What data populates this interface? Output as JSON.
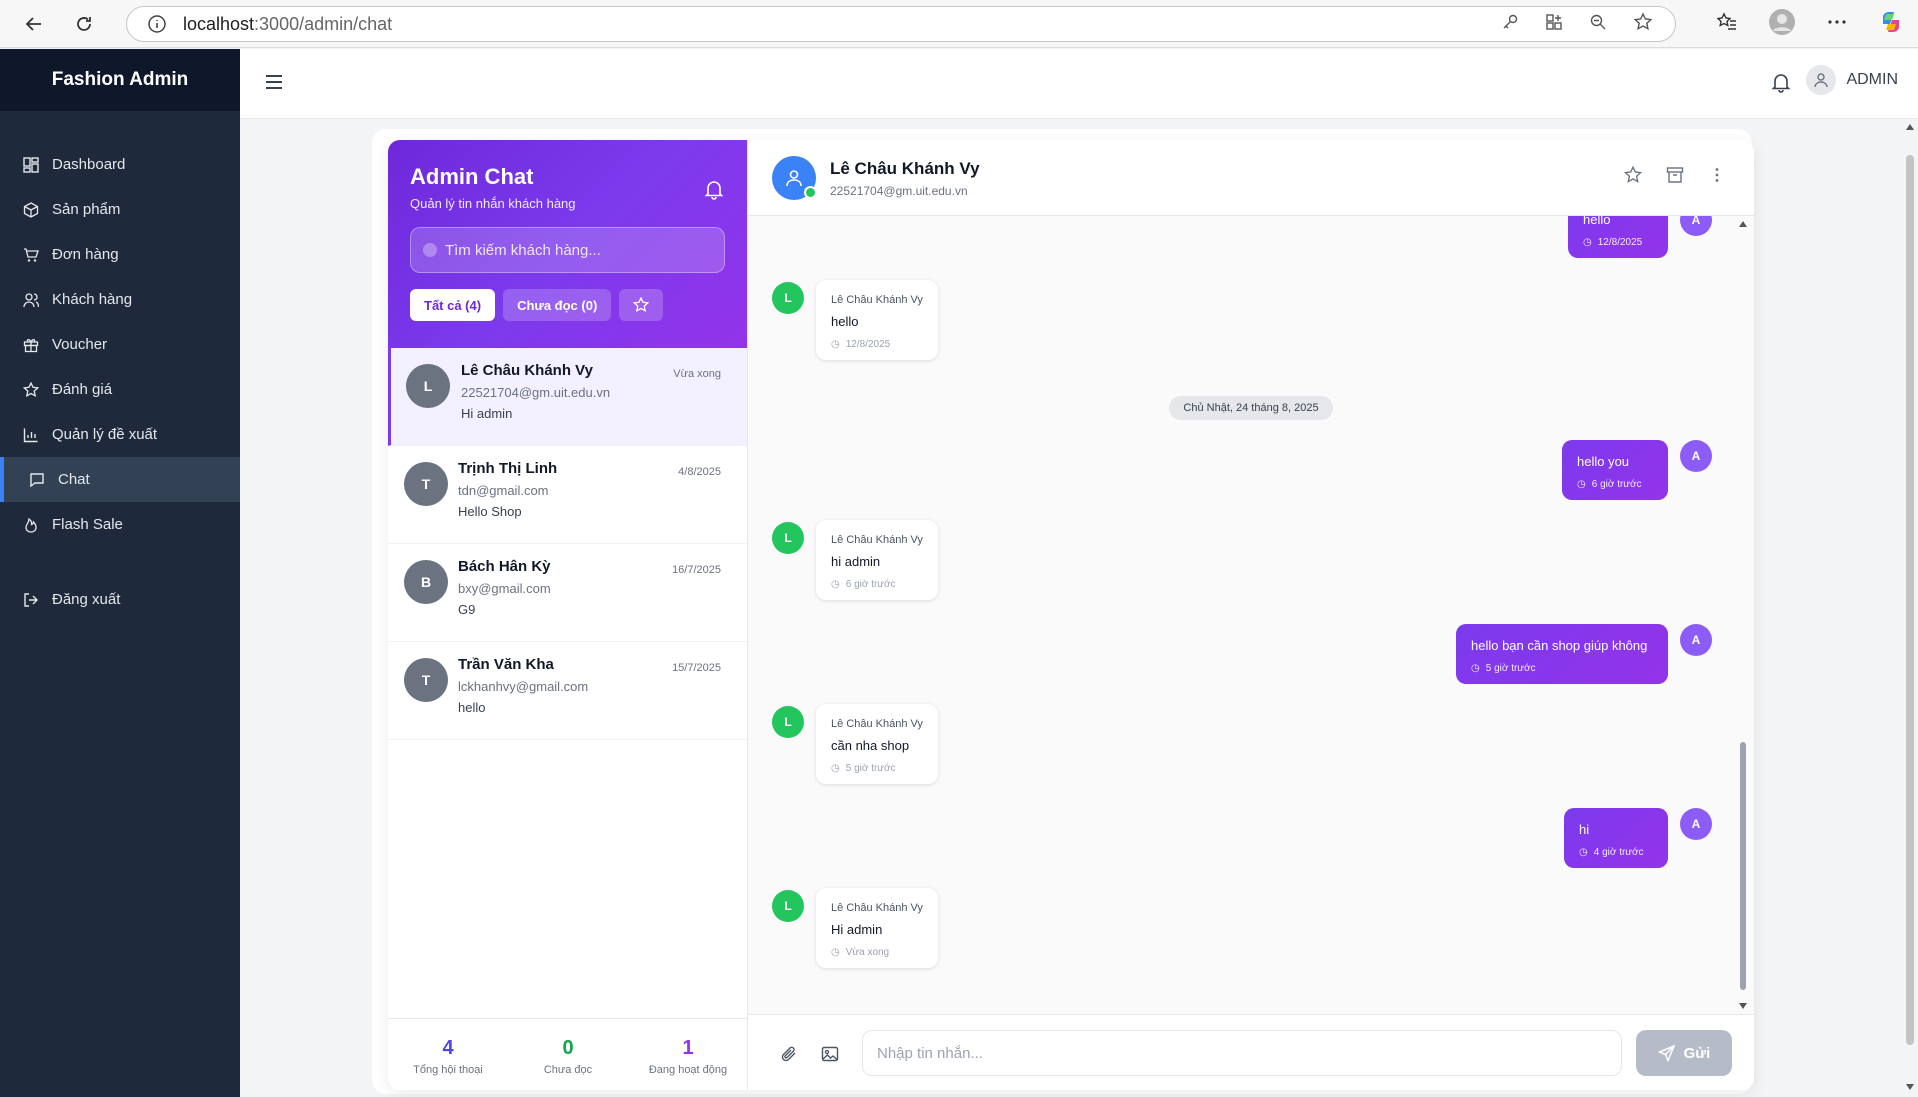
{
  "browser": {
    "url_host": "localhost",
    "url_path": ":3000/admin/chat"
  },
  "sidebar": {
    "brand": "Fashion Admin",
    "items": [
      {
        "label": "Dashboard",
        "icon": "dashboard-icon"
      },
      {
        "label": "Sản phẩm",
        "icon": "box-icon"
      },
      {
        "label": "Đơn hàng",
        "icon": "cart-icon"
      },
      {
        "label": "Khách hàng",
        "icon": "users-icon"
      },
      {
        "label": "Voucher",
        "icon": "gift-icon"
      },
      {
        "label": "Đánh giá",
        "icon": "star-icon"
      },
      {
        "label": "Quản lý đề xuất",
        "icon": "chart-icon"
      },
      {
        "label": "Chat",
        "icon": "chat-icon",
        "active": true
      },
      {
        "label": "Flash Sale",
        "icon": "flame-icon"
      }
    ],
    "logout": "Đăng xuất"
  },
  "topbar": {
    "user_label": "ADMIN"
  },
  "chat_list": {
    "title": "Admin Chat",
    "subtitle": "Quản lý tin nhắn khách hàng",
    "search_placeholder": "Tìm kiếm khách hàng...",
    "filters": {
      "all": "Tất cả (4)",
      "unread": "Chưa đọc (0)"
    },
    "conversations": [
      {
        "initial": "L",
        "name": "Lê Châu Khánh Vy",
        "email": "22521704@gm.uit.edu.vn",
        "last": "Hi admin",
        "time": "Vừa xong"
      },
      {
        "initial": "T",
        "name": "Trịnh Thị Linh",
        "email": "tdn@gmail.com",
        "last": "Hello Shop",
        "time": "4/8/2025"
      },
      {
        "initial": "B",
        "name": "Bách Hân Kỳ",
        "email": "bxy@gmail.com",
        "last": "G9",
        "time": "16/7/2025"
      },
      {
        "initial": "T",
        "name": "Trần Văn Kha",
        "email": "lckhanhvy@gmail.com",
        "last": "hello",
        "time": "15/7/2025"
      }
    ],
    "stats": [
      {
        "value": "4",
        "label": "Tổng hội thoại",
        "color": "#4f46e5"
      },
      {
        "value": "0",
        "label": "Chưa đọc",
        "color": "#16a34a"
      },
      {
        "value": "1",
        "label": "Đang hoạt động",
        "color": "#9333ea"
      }
    ]
  },
  "chat": {
    "contact_name": "Lê Châu Khánh Vy",
    "contact_email": "22521704@gm.uit.edu.vn",
    "messages": {
      "m0": {
        "text": "hello",
        "time": "12/8/2025",
        "avatar": "A"
      },
      "m1": {
        "sender": "Lê Châu Khánh Vy",
        "text": "hello",
        "time": "12/8/2025",
        "avatar": "L"
      },
      "date": "Chủ Nhật, 24 tháng 8, 2025",
      "m2": {
        "text": "hello you",
        "time": "6 giờ trước",
        "avatar": "A"
      },
      "m3": {
        "sender": "Lê Châu Khánh Vy",
        "text": "hi admin",
        "time": "6 giờ trước",
        "avatar": "L"
      },
      "m4": {
        "text": "hello bạn cần shop giúp không",
        "time": "5 giờ trước",
        "avatar": "A"
      },
      "m5": {
        "sender": "Lê Châu Khánh Vy",
        "text": "cần nha shop",
        "time": "5 giờ trước",
        "avatar": "L"
      },
      "m6": {
        "text": "hi",
        "time": "4 giờ trước",
        "avatar": "A"
      },
      "m7": {
        "sender": "Lê Châu Khánh Vy",
        "text": "Hi admin",
        "time": "Vừa xong",
        "avatar": "L"
      }
    },
    "composer_placeholder": "Nhập tin nhắn...",
    "send_label": "Gửi"
  }
}
